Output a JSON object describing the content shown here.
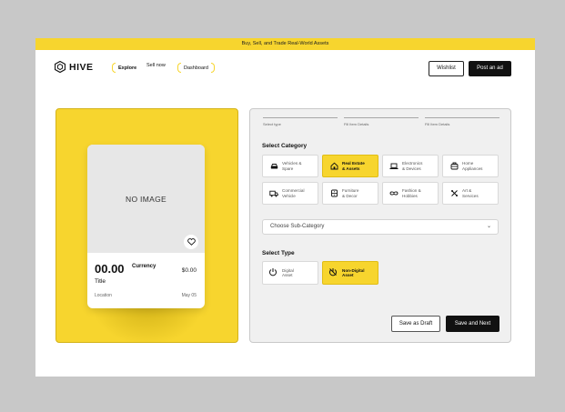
{
  "banner": {
    "text": "Buy, Sell, and Trade Real-World Assets"
  },
  "nav": {
    "logo": "HIVE",
    "links": [
      {
        "label": "Explore",
        "active": true
      },
      {
        "label": "Sell now",
        "active": false
      },
      {
        "label": "Dashboard",
        "active": false
      }
    ],
    "wishlist": "Wishlist",
    "post_ad": "Post an ad"
  },
  "preview": {
    "image_placeholder": "NO IMAGE",
    "price": "00.00",
    "currency": "Currency",
    "price_right": "$0.00",
    "title": "Title",
    "location": "Location",
    "date": "May 05"
  },
  "steps": [
    {
      "label": "Select type"
    },
    {
      "label": "Fill Item Details"
    },
    {
      "label": "Fill Item Details"
    }
  ],
  "category": {
    "title": "Select Category",
    "items": [
      {
        "label": "Vehicles &\nSpare",
        "icon": "car-icon",
        "selected": false
      },
      {
        "label": "Real Estate\n& Assets",
        "icon": "home-icon",
        "selected": true
      },
      {
        "label": "Electronics\n& Devices",
        "icon": "laptop-icon",
        "selected": false
      },
      {
        "label": "Home\nAppliances",
        "icon": "appliance-icon",
        "selected": false
      },
      {
        "label": "Commercial\nVehicle",
        "icon": "truck-icon",
        "selected": false
      },
      {
        "label": "Furniture\n& Decor",
        "icon": "furniture-icon",
        "selected": false
      },
      {
        "label": "Fashion &\nHobbies",
        "icon": "fashion-icon",
        "selected": false
      },
      {
        "label": "Art &\nServices",
        "icon": "art-icon",
        "selected": false
      }
    ]
  },
  "subcategory": {
    "placeholder": "Choose Sub-Category"
  },
  "type": {
    "title": "Select Type",
    "items": [
      {
        "label": "Digital\nAsset",
        "icon": "power-icon",
        "selected": false
      },
      {
        "label": "Non-Digital\nAsset",
        "icon": "no-power-icon",
        "selected": true
      }
    ]
  },
  "actions": {
    "draft": "Save as Draft",
    "next": "Save and Next"
  },
  "colors": {
    "accent": "#f7d52e",
    "dark": "#111111",
    "background": "#c8c8c8"
  }
}
